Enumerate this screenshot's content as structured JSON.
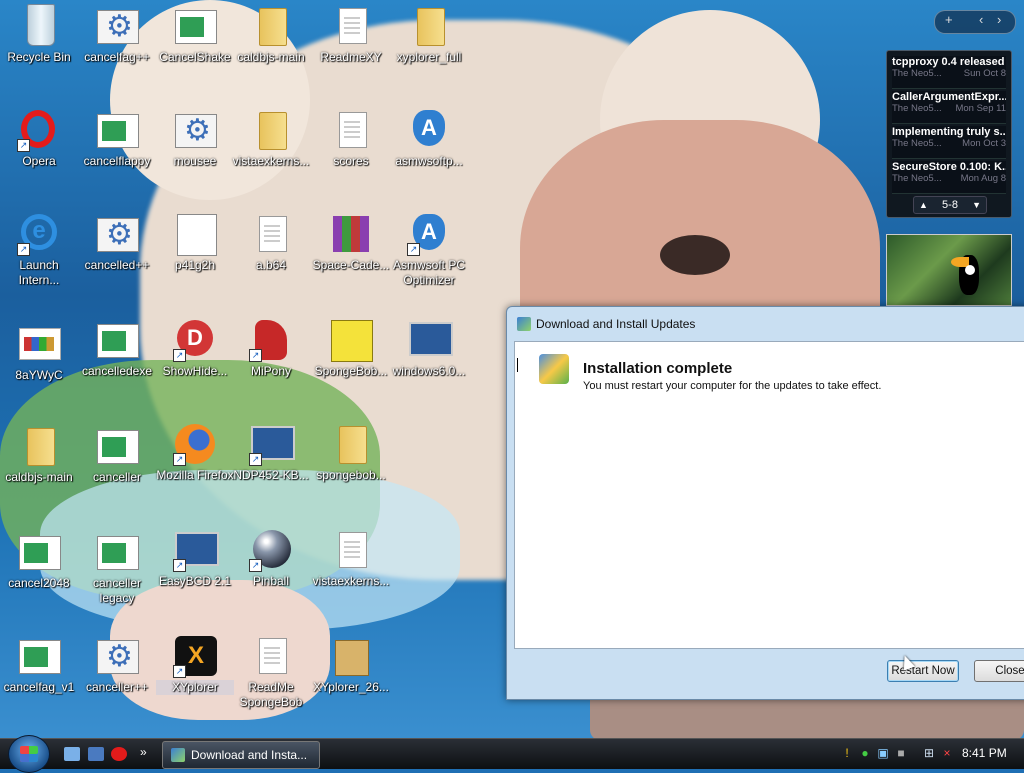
{
  "desktop": {
    "icons": [
      {
        "label": "Recycle Bin"
      },
      {
        "label": "cancelfag++"
      },
      {
        "label": "CancelShake"
      },
      {
        "label": "caldbjs-main"
      },
      {
        "label": "ReadmeXY"
      },
      {
        "label": "xyplorer_full"
      },
      {
        "label": "Opera"
      },
      {
        "label": "cancelflappy"
      },
      {
        "label": "mousee"
      },
      {
        "label": "vistaexkerns..."
      },
      {
        "label": "scores"
      },
      {
        "label": "asmwsoftp..."
      },
      {
        "label": "Launch Intern..."
      },
      {
        "label": "cancelled++"
      },
      {
        "label": "p41g2h"
      },
      {
        "label": "a.b64"
      },
      {
        "label": "Space-Cade..."
      },
      {
        "label": "Asmwsoft PC Optimizer"
      },
      {
        "label": "8aYWyC"
      },
      {
        "label": "cancelledexe"
      },
      {
        "label": "ShowHide..."
      },
      {
        "label": "MiPony"
      },
      {
        "label": "SpongeBob..."
      },
      {
        "label": "windows6.0..."
      },
      {
        "label": "caldbjs-main"
      },
      {
        "label": "canceller"
      },
      {
        "label": "Mozilla Firefox"
      },
      {
        "label": "NDP452-KB..."
      },
      {
        "label": "spongebob..."
      },
      {
        "label": "cancel2048"
      },
      {
        "label": "canceller legacy"
      },
      {
        "label": "EasyBCD 2.1"
      },
      {
        "label": "Pinball"
      },
      {
        "label": "vistaexkerns..."
      },
      {
        "label": "cancelfag_v1"
      },
      {
        "label": "canceller++"
      },
      {
        "label": "XYplorer"
      },
      {
        "label": "ReadMe SpongeBob"
      },
      {
        "label": "XYplorer_26..."
      }
    ]
  },
  "sidebar": {
    "controls": {
      "add": "+",
      "prev": "‹",
      "next": "›"
    },
    "feed": {
      "items": [
        {
          "title": "tcpproxy 0.4 released",
          "source": "The Neo5...",
          "date": "Sun Oct 8"
        },
        {
          "title": "CallerArgumentExpr...",
          "source": "The Neo5...",
          "date": "Mon Sep 11"
        },
        {
          "title": "Implementing truly s...",
          "source": "The Neo5...",
          "date": "Mon Oct 3"
        },
        {
          "title": "SecureStore 0.100: K...",
          "source": "The Neo5...",
          "date": "Mon Aug 8"
        }
      ],
      "pager": "5-8",
      "pager_prev": "▲",
      "pager_next": "▼"
    }
  },
  "dialog": {
    "title": "Download and Install Updates",
    "heading": "Installation complete",
    "message": "You must restart your computer for the updates to take effect.",
    "restart_label": "Restart Now",
    "close_label": "Close"
  },
  "taskbar": {
    "task_label": "Download and Insta...",
    "clock": "8:41 PM",
    "overflow": "»"
  }
}
